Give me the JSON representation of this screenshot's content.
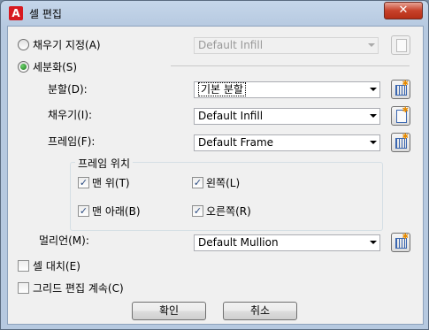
{
  "window": {
    "title": "셀 편집",
    "app_icon_letter": "A",
    "close_glyph": "✕"
  },
  "options": {
    "set_infill": {
      "label": "채우기 지정(A)",
      "checked": false,
      "combo_value": "Default Infill",
      "enabled": false
    },
    "subdivide": {
      "label": "세분화(S)",
      "checked": true
    }
  },
  "fields": {
    "division": {
      "label": "분할(D):",
      "value": "기본 분할"
    },
    "infill": {
      "label": "채우기(I):",
      "value": "Default Infill"
    },
    "frame": {
      "label": "프레임(F):",
      "value": "Default Frame"
    },
    "mullion": {
      "label": "멀리언(M):",
      "value": "Default Mullion"
    }
  },
  "frame_position": {
    "title": "프레임 위치",
    "top": {
      "label": "맨 위(T)",
      "checked": true
    },
    "left": {
      "label": "왼쪽(L)",
      "checked": true
    },
    "bottom": {
      "label": "맨 아래(B)",
      "checked": true
    },
    "right": {
      "label": "오른쪽(R)",
      "checked": true
    }
  },
  "checkboxes": {
    "cell_replace": {
      "label": "셀 대치(E)",
      "checked": false
    },
    "continue_grid_edit": {
      "label": "그리드 편집 계속(C)",
      "checked": false
    }
  },
  "buttons": {
    "ok": "확인",
    "cancel": "취소"
  },
  "check_glyph": "✓",
  "star_glyph": "✱"
}
